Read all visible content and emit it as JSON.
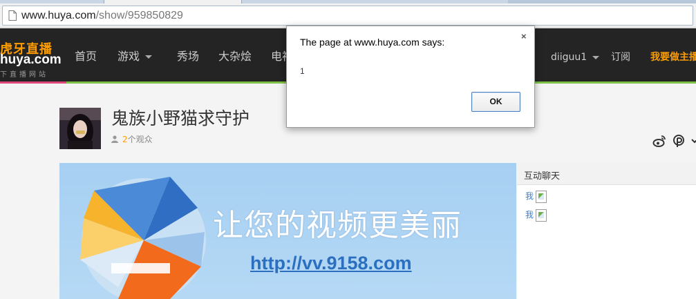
{
  "browser": {
    "url_host": "www.huya.com",
    "url_path": "/show/959850829",
    "page_icon": "page-icon"
  },
  "nav": {
    "logo_cn": "虎牙直播",
    "logo_en": "huya.com",
    "logo_tagline": "下直播网站",
    "items": [
      "首页",
      "游戏",
      "秀场",
      "大杂烩",
      "电视"
    ],
    "user_name": "diiguu1",
    "subscribe_label": "订阅",
    "become_host_label": "我要做主播",
    "colors": {
      "bar_bg": "#242424",
      "accent_green": "#7dc246",
      "accent_pink": "#e0457b",
      "brand_orange": "#ff9c00"
    }
  },
  "room": {
    "title": "鬼族小野猫求守护",
    "viewer_count": "2",
    "viewer_suffix": "个观众",
    "share_icons": [
      "weibo-icon",
      "pengyou-icon"
    ]
  },
  "video": {
    "ad_text": "让您的视频更美丽",
    "ad_link": "http://vv.9158.com"
  },
  "chat": {
    "title": "互动聊天",
    "messages": [
      {
        "sender": "我",
        "content": "broken-image-icon"
      },
      {
        "sender": "我",
        "content": "broken-image-icon"
      }
    ]
  },
  "dialog": {
    "title": "The page at www.huya.com says:",
    "message": "1",
    "ok_label": "OK",
    "close_label": "×"
  }
}
